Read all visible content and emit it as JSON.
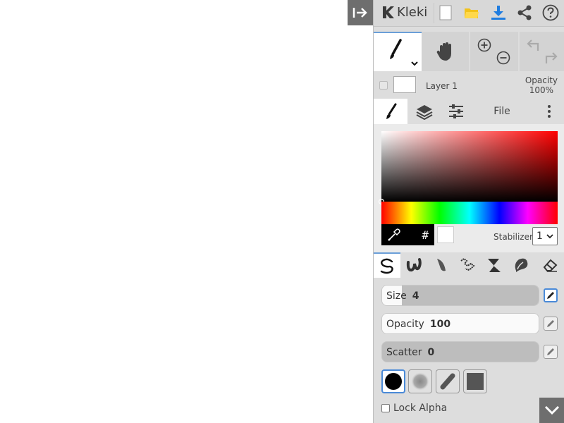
{
  "app": {
    "name": "Kleki"
  },
  "layer": {
    "name": "Layer 1",
    "opacity_label": "Opacity",
    "opacity_value": "100%"
  },
  "tabs": {
    "file_label": "File"
  },
  "color": {
    "hash_symbol": "#",
    "stabilizer_label": "Stabilizer",
    "stabilizer_value": "1"
  },
  "brush": {
    "size_label": "Size",
    "size_value": "4",
    "size_fraction": 0.03,
    "opacity_label": "Opacity",
    "opacity_value": "100",
    "opacity_fraction": 1.0,
    "scatter_label": "Scatter",
    "scatter_value": "0",
    "scatter_fraction": 0.0
  },
  "options": {
    "lock_alpha_label": "Lock Alpha"
  },
  "colors": {
    "accent": "#4a8ad8",
    "download_blue": "#1f7de0",
    "folder_yellow": "#f2c21a"
  }
}
